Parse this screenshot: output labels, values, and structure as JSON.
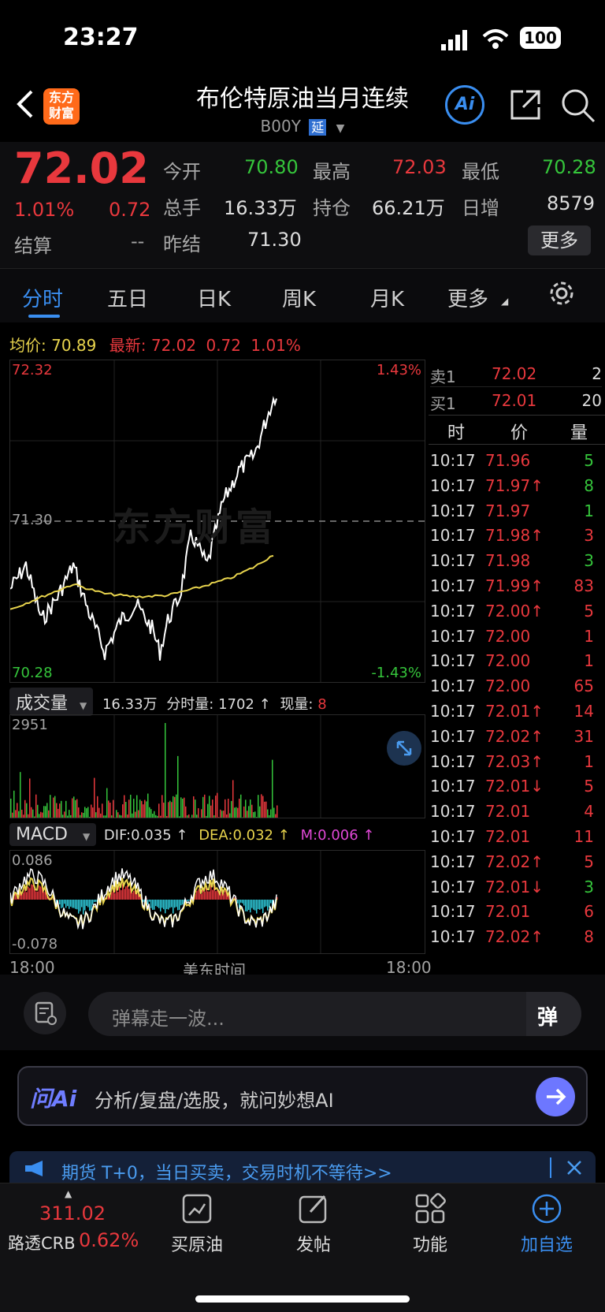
{
  "status": {
    "time": "23:27",
    "battery": "100"
  },
  "header": {
    "title": "布伦特原油当月连续",
    "code": "B00Y",
    "delay_badge": "延",
    "brand_line1": "东方",
    "brand_line2": "财富",
    "ai_label": "Ai"
  },
  "quote": {
    "price": "72.02",
    "change_pct": "1.01%",
    "change": "0.72",
    "settle_label": "结算",
    "settle": "--",
    "open_label": "今开",
    "open": "70.80",
    "high_label": "最高",
    "high": "72.03",
    "low_label": "最低",
    "low": "70.28",
    "volume_label": "总手",
    "volume": "16.33万",
    "oi_label": "持仓",
    "oi": "66.21万",
    "daily_inc_label": "日增",
    "daily_inc": "8579",
    "prev_settle_label": "昨结",
    "prev_settle": "71.30",
    "more_button": "更多"
  },
  "tabs": [
    "分时",
    "五日",
    "日K",
    "周K",
    "月K",
    "更多"
  ],
  "chart_info": {
    "avg_label": "均价:",
    "avg": "70.89",
    "latest_label": "最新:",
    "latest": "72.02",
    "chg": "0.72",
    "pct": "1.01%"
  },
  "price_axis": {
    "top": "72.32",
    "mid": "71.30",
    "bottom": "70.28",
    "top_pct": "1.43%",
    "bottom_pct": "-1.43%",
    "watermark": "东方财富"
  },
  "volume_panel": {
    "label": "成交量",
    "total": "16.33万",
    "time_vol_label": "分时量:",
    "time_vol": "1702",
    "cur_vol_label": "现量:",
    "cur_vol": "8",
    "max": "2951"
  },
  "macd_panel": {
    "label": "MACD",
    "dif": "DIF:0.035 ↑",
    "dea": "DEA:0.032 ↑",
    "m": "M:0.006 ↑",
    "top": "0.086",
    "bottom": "-0.078"
  },
  "time_axis": {
    "left": "18:00",
    "center": "美东时间",
    "right": "18:00"
  },
  "order_book": {
    "ask": {
      "label": "卖1",
      "price": "72.02",
      "qty": "2"
    },
    "bid": {
      "label": "买1",
      "price": "72.01",
      "qty": "20"
    },
    "headers": [
      "时",
      "价",
      "量"
    ],
    "trades": [
      {
        "t": "10:17",
        "p": "71.96",
        "q": "5",
        "pc": "red",
        "qc": "green"
      },
      {
        "t": "10:17",
        "p": "71.97↑",
        "q": "8",
        "pc": "red",
        "qc": "green"
      },
      {
        "t": "10:17",
        "p": "71.97",
        "q": "1",
        "pc": "red",
        "qc": "green"
      },
      {
        "t": "10:17",
        "p": "71.98↑",
        "q": "3",
        "pc": "red",
        "qc": "red"
      },
      {
        "t": "10:17",
        "p": "71.98",
        "q": "3",
        "pc": "red",
        "qc": "green"
      },
      {
        "t": "10:17",
        "p": "71.99↑",
        "q": "83",
        "pc": "red",
        "qc": "red"
      },
      {
        "t": "10:17",
        "p": "72.00↑",
        "q": "5",
        "pc": "red",
        "qc": "red"
      },
      {
        "t": "10:17",
        "p": "72.00",
        "q": "1",
        "pc": "red",
        "qc": "red"
      },
      {
        "t": "10:17",
        "p": "72.00",
        "q": "1",
        "pc": "red",
        "qc": "red"
      },
      {
        "t": "10:17",
        "p": "72.00",
        "q": "65",
        "pc": "red",
        "qc": "red"
      },
      {
        "t": "10:17",
        "p": "72.01↑",
        "q": "14",
        "pc": "red",
        "qc": "red"
      },
      {
        "t": "10:17",
        "p": "72.02↑",
        "q": "31",
        "pc": "red",
        "qc": "red"
      },
      {
        "t": "10:17",
        "p": "72.03↑",
        "q": "1",
        "pc": "red",
        "qc": "red"
      },
      {
        "t": "10:17",
        "p": "72.01↓",
        "q": "5",
        "pc": "red",
        "qc": "red"
      },
      {
        "t": "10:17",
        "p": "72.01",
        "q": "4",
        "pc": "red",
        "qc": "red"
      },
      {
        "t": "10:17",
        "p": "72.01",
        "q": "11",
        "pc": "red",
        "qc": "red"
      },
      {
        "t": "10:17",
        "p": "72.02↑",
        "q": "5",
        "pc": "red",
        "qc": "red"
      },
      {
        "t": "10:17",
        "p": "72.01↓",
        "q": "3",
        "pc": "red",
        "qc": "green"
      },
      {
        "t": "10:17",
        "p": "72.01",
        "q": "6",
        "pc": "red",
        "qc": "red"
      },
      {
        "t": "10:17",
        "p": "72.02↑",
        "q": "8",
        "pc": "red",
        "qc": "red"
      }
    ]
  },
  "danmaku": {
    "placeholder": "弹幕走一波...",
    "button": "弹"
  },
  "ask_ai": {
    "logo": "问Ai",
    "placeholder": "分析/复盘/选股，就问妙想AI"
  },
  "banner": {
    "text": "期货 T+0，当日买卖，交易时机不等待>>"
  },
  "bottom_bar": {
    "index_value": "311.02",
    "index_name": "路透CRB",
    "index_pct": "0.62%",
    "items": [
      "买原油",
      "发帖",
      "功能",
      "加自选"
    ]
  },
  "colors": {
    "up": "#e8383d",
    "down": "#35c53b",
    "accent": "#3a8ef0",
    "avg_line": "#e8d44d"
  }
}
